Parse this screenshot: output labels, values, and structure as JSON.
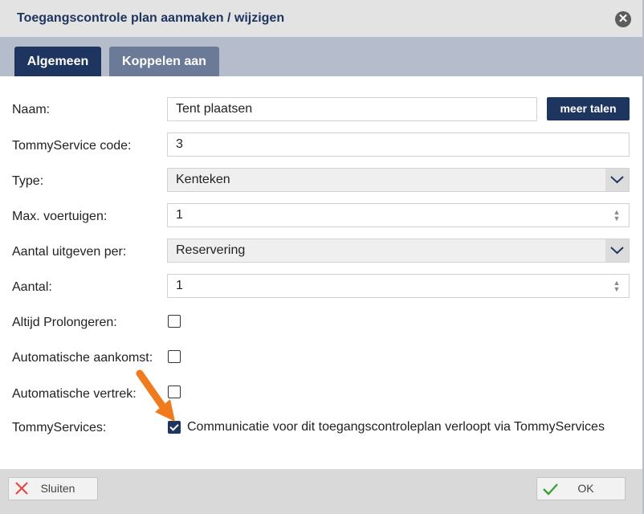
{
  "dialog": {
    "title": "Toegangscontrole plan aanmaken / wijzigen"
  },
  "tabs": [
    {
      "label": "Algemeen",
      "active": true
    },
    {
      "label": "Koppelen aan",
      "active": false
    }
  ],
  "form": {
    "naam": {
      "label": "Naam:",
      "value": "Tent plaatsen",
      "more_langs_label": "meer talen"
    },
    "code": {
      "label": "TommyService code:",
      "value": "3"
    },
    "type": {
      "label": "Type:",
      "value": "Kenteken"
    },
    "max_voertuigen": {
      "label": "Max. voertuigen:",
      "value": "1"
    },
    "aantal_per": {
      "label": "Aantal uitgeven per:",
      "value": "Reservering"
    },
    "aantal": {
      "label": "Aantal:",
      "value": "1"
    },
    "altijd_prolongeren": {
      "label": "Altijd Prolongeren:",
      "checked": false
    },
    "auto_aankomst": {
      "label": "Automatische aankomst:",
      "checked": false
    },
    "auto_vertrek": {
      "label": "Automatische vertrek:",
      "checked": false
    },
    "tommyservices": {
      "label": "TommyServices:",
      "checked": true,
      "checkbox_text": "Communicatie voor dit toegangscontroleplan verloopt via TommyServices"
    }
  },
  "footer": {
    "close_label": "Sluiten",
    "ok_label": "OK"
  },
  "colors": {
    "accent": "#1e3560",
    "annotation_arrow": "#f07a1e"
  }
}
